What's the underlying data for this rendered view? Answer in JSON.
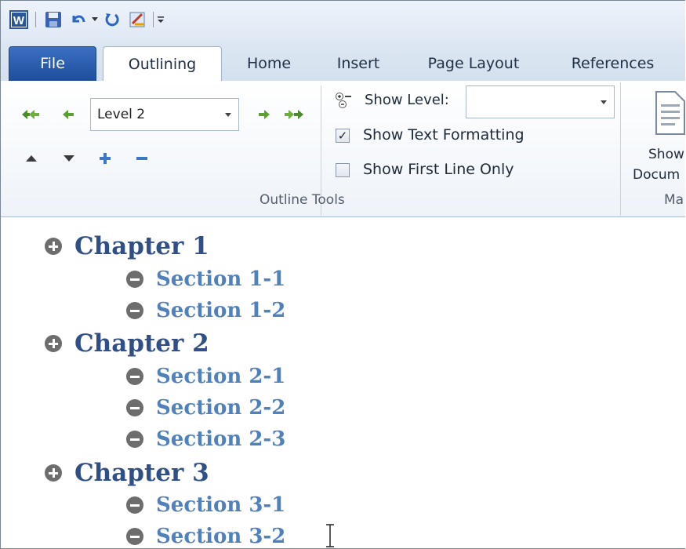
{
  "quick_access": {
    "icons": [
      "word-icon",
      "save-icon",
      "undo-icon",
      "undo-dropdown-icon",
      "redo-icon",
      "custom-icon",
      "customize-dropdown-icon"
    ]
  },
  "tabs": [
    {
      "label": "File"
    },
    {
      "label": "Outlining"
    },
    {
      "label": "Home"
    },
    {
      "label": "Insert"
    },
    {
      "label": "Page Layout"
    },
    {
      "label": "References"
    }
  ],
  "ribbon": {
    "level_value": "Level 2",
    "show_level_label": "Show Level:",
    "show_level_value": "",
    "show_text_formatting_label": "Show Text Formatting",
    "show_text_formatting_checked": true,
    "show_first_line_only_label": "Show First Line Only",
    "show_first_line_only_checked": false,
    "outline_tools_label": "Outline Tools",
    "show_document_label_line1": "Show",
    "show_document_label_line2": "Docum",
    "master_group_label": "Ma"
  },
  "document": {
    "outline": [
      {
        "label": "Chapter 1",
        "level": 1,
        "symbol": "plus"
      },
      {
        "label": "Section 1-1",
        "level": 2,
        "symbol": "minus"
      },
      {
        "label": "Section 1-2",
        "level": 2,
        "symbol": "minus"
      },
      {
        "label": "Chapter 2",
        "level": 1,
        "symbol": "plus"
      },
      {
        "label": "Section 2-1",
        "level": 2,
        "symbol": "minus"
      },
      {
        "label": "Section 2-2",
        "level": 2,
        "symbol": "minus"
      },
      {
        "label": "Section 2-3",
        "level": 2,
        "symbol": "minus"
      },
      {
        "label": "Chapter 3",
        "level": 1,
        "symbol": "plus"
      },
      {
        "label": "Section 3-1",
        "level": 2,
        "symbol": "minus"
      },
      {
        "label": "Section 3-2",
        "level": 2,
        "symbol": "minus"
      }
    ]
  },
  "colors": {
    "chapter": "#2f4f86",
    "section": "#4f81bd",
    "file_tab": "#2a5caa"
  }
}
